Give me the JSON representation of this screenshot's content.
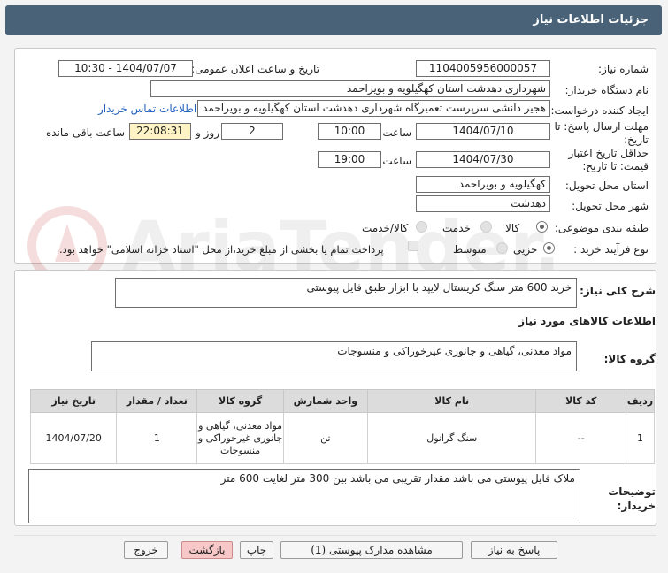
{
  "header": {
    "title": "جزئیات اطلاعات نیاز"
  },
  "fields": {
    "need_number_label": "شماره نیاز:",
    "need_number": "1104005956000057",
    "announce_label": "تاریخ و ساعت اعلان عمومی:",
    "announce_value": "1404/07/07 - 10:30",
    "buyer_org_label": "نام دستگاه خریدار:",
    "buyer_org": "شهرداری دهدشت استان کهگیلویه و بویراحمد",
    "creator_label": "ایجاد کننده درخواست:",
    "creator": "هجیر دانشی سرپرست تعمیرگاه شهرداری دهدشت استان کهگیلویه و بویراحمد",
    "contact_link": "اطلاعات تماس خریدار",
    "deadline_label": "مهلت ارسال پاسخ: تا تاریخ:",
    "deadline_date": "1404/07/10",
    "time_label": "ساعت",
    "deadline_time": "10:00",
    "days_value": "2",
    "days_label": "روز و",
    "remaining_time": "22:08:31",
    "remaining_label": "ساعت باقی مانده",
    "validity_label": "حداقل تاریخ اعتبار قیمت: تا تاریخ:",
    "validity_date": "1404/07/30",
    "validity_time": "19:00",
    "province_label": "استان محل تحویل:",
    "province": "کهگیلویه و بویراحمد",
    "city_label": "شهر محل تحویل:",
    "city": "دهدشت",
    "category_label": "طبقه بندی موضوعی:",
    "category_options": [
      "کالا",
      "خدمت",
      "کالا/خدمت"
    ],
    "process_label": "نوع فرآیند خرید :",
    "process_options": [
      "جزیی",
      "متوسط"
    ],
    "treasury_text": "پرداخت تمام یا بخشی از مبلغ خرید،از محل \"اسناد خزانه اسلامی\" خواهد بود."
  },
  "watermark": {
    "text": "AriaTender.neT"
  },
  "summary": {
    "label": "شرح کلی نیاز:",
    "value": "خرید 600 متر  سنگ کریستال لایپد با ابزار طبق فایل پیوستی"
  },
  "goods_section_title": "اطلاعات کالاهای مورد نیاز",
  "goods_group": {
    "label": "گروه کالا:",
    "value": "مواد معدنی، گیاهی و جانوری غیرخوراکی و منسوجات"
  },
  "table": {
    "headers": [
      "ردیف",
      "کد کالا",
      "نام کالا",
      "واحد شمارش",
      "گروه کالا",
      "تعداد / مقدار",
      "تاریخ نیاز"
    ],
    "rows": [
      [
        "1",
        "--",
        "سنگ گرانول",
        "تن",
        "مواد معدنی، گیاهی و جانوری غیرخوراکی و منسوجات",
        "1",
        "1404/07/20"
      ]
    ]
  },
  "notes": {
    "label": "توضیحات خریدار:",
    "value": "ملاک فایل پیوستی می باشد مقدار تقریبی می باشد بین 300 متر لغایت 600 متر"
  },
  "buttons": {
    "reply": "پاسخ به نیاز",
    "attachments": "مشاهده مدارک پیوستی (1)",
    "print": "چاپ",
    "back": "بازگشت",
    "exit": "خروج"
  }
}
